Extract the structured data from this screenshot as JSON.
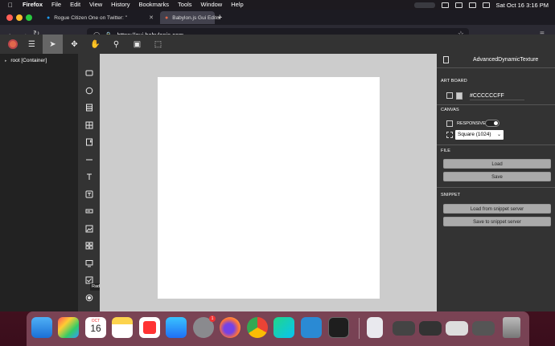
{
  "menubar": {
    "app_name": "Firefox",
    "items": [
      "File",
      "Edit",
      "View",
      "History",
      "Bookmarks",
      "Tools",
      "Window",
      "Help"
    ],
    "clock": "Sat Oct 16  3:16 PM"
  },
  "browser": {
    "tabs": [
      {
        "title": "Rogue Citizen One on Twitter: \"",
        "active": false
      },
      {
        "title": "Babylon.js Gui Editor",
        "active": true
      }
    ],
    "url": "https://gui.babylonjs.com"
  },
  "tree": {
    "root_label": "root [Container]"
  },
  "toolbox": {
    "tooltip": "RadioButton"
  },
  "panel": {
    "title": "AdvancedDynamicTexture",
    "sections": {
      "artboard": "ART BOARD",
      "canvas": "CANVAS",
      "file": "FILE",
      "snippet": "SNIPPET"
    },
    "artboard_color": "#CCCCCCFF",
    "responsive_label": "RESPONSIVE",
    "canvas_size": "Square (1024)",
    "buttons": {
      "load": "Load",
      "save": "Save",
      "load_snippet": "Load from snippet server",
      "save_snippet": "Save to snippet server"
    }
  },
  "dock": {
    "calendar_month": "OCT",
    "calendar_day": "16",
    "settings_badge": "1"
  },
  "colors": {
    "toolbar_bg": "#333333",
    "workbench_bg": "#cccccc",
    "logo": "#e0684b"
  }
}
